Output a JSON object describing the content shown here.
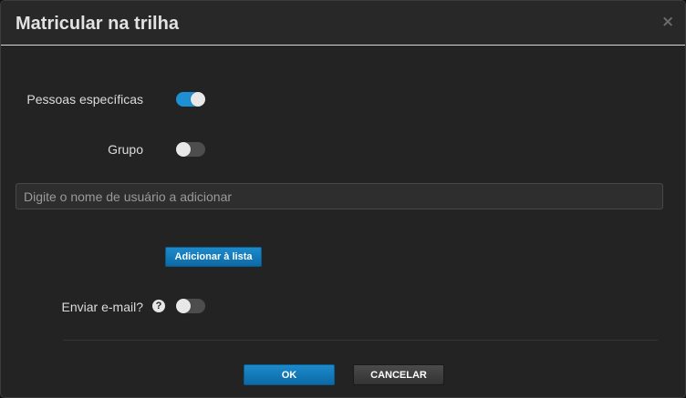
{
  "dialog": {
    "title": "Matricular na trilha",
    "close_symbol": "×"
  },
  "options": {
    "specific_people": {
      "label": "Pessoas específicas",
      "enabled": true
    },
    "group": {
      "label": "Grupo",
      "enabled": false
    }
  },
  "username_input": {
    "placeholder": "Digite o nome de usuário a adicionar",
    "value": ""
  },
  "add_button": {
    "label": "Adicionar à lista"
  },
  "send_email": {
    "label": "Enviar e-mail?",
    "help_symbol": "?",
    "enabled": false
  },
  "footer": {
    "ok_label": "OK",
    "cancel_label": "CANCELAR"
  },
  "colors": {
    "accent": "#1e8fd4",
    "background": "#232323",
    "toggle_off": "#4d4d4d"
  },
  "icons": {
    "close": "close-icon",
    "help": "question-circle-icon"
  }
}
